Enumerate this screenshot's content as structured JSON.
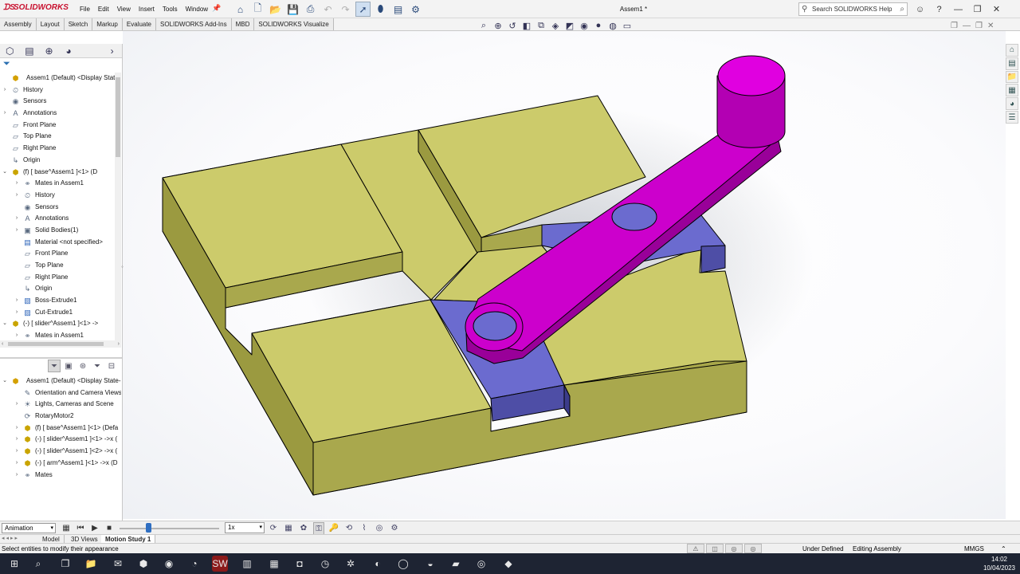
{
  "app": {
    "logo_text": "SOLIDWORKS",
    "document_title": "Assem1 *",
    "menu": [
      "File",
      "Edit",
      "View",
      "Insert",
      "Tools",
      "Window"
    ],
    "search_placeholder": "Search SOLIDWORKS Help"
  },
  "command_tabs": [
    "Assembly",
    "Layout",
    "Sketch",
    "Markup",
    "Evaluate",
    "SOLIDWORKS Add-Ins",
    "MBD",
    "SOLIDWORKS Visualize"
  ],
  "feature_tree": [
    {
      "label": "Assem1 (Default) <Display State",
      "indent": 0,
      "arrow": "",
      "icon": "assembly-icon"
    },
    {
      "label": "History",
      "indent": 0,
      "arrow": "›",
      "icon": "history-icon"
    },
    {
      "label": "Sensors",
      "indent": 0,
      "arrow": "",
      "icon": "sensor-icon"
    },
    {
      "label": "Annotations",
      "indent": 0,
      "arrow": "›",
      "icon": "annotation-icon"
    },
    {
      "label": "Front Plane",
      "indent": 0,
      "arrow": "",
      "icon": "plane-icon"
    },
    {
      "label": "Top Plane",
      "indent": 0,
      "arrow": "",
      "icon": "plane-icon"
    },
    {
      "label": "Right Plane",
      "indent": 0,
      "arrow": "",
      "icon": "plane-icon"
    },
    {
      "label": "Origin",
      "indent": 0,
      "arrow": "",
      "icon": "origin-icon"
    },
    {
      "label": "(f) [ base^Assem1 ]<1> (D",
      "indent": 0,
      "arrow": "⌄",
      "icon": "part-icon"
    },
    {
      "label": "Mates in Assem1",
      "indent": 1,
      "arrow": "›",
      "icon": "mates-icon"
    },
    {
      "label": "History",
      "indent": 1,
      "arrow": "›",
      "icon": "history-icon"
    },
    {
      "label": "Sensors",
      "indent": 1,
      "arrow": "",
      "icon": "sensor-icon"
    },
    {
      "label": "Annotations",
      "indent": 1,
      "arrow": "›",
      "icon": "annotation-icon"
    },
    {
      "label": "Solid Bodies(1)",
      "indent": 1,
      "arrow": "›",
      "icon": "solid-bodies-icon"
    },
    {
      "label": "Material <not specified>",
      "indent": 1,
      "arrow": "",
      "icon": "material-icon"
    },
    {
      "label": "Front Plane",
      "indent": 1,
      "arrow": "",
      "icon": "plane-icon"
    },
    {
      "label": "Top Plane",
      "indent": 1,
      "arrow": "",
      "icon": "plane-icon"
    },
    {
      "label": "Right Plane",
      "indent": 1,
      "arrow": "",
      "icon": "plane-icon"
    },
    {
      "label": "Origin",
      "indent": 1,
      "arrow": "",
      "icon": "origin-icon"
    },
    {
      "label": "Boss-Extrude1",
      "indent": 1,
      "arrow": "›",
      "icon": "extrude-icon"
    },
    {
      "label": "Cut-Extrude1",
      "indent": 1,
      "arrow": "›",
      "icon": "cut-extrude-icon"
    },
    {
      "label": "(-) [ slider^Assem1 ]<1> ->",
      "indent": 0,
      "arrow": "⌄",
      "icon": "part-icon"
    },
    {
      "label": "Mates in Assem1",
      "indent": 1,
      "arrow": "›",
      "icon": "mates-icon"
    }
  ],
  "motion_tree": [
    {
      "label": "Assem1 (Default) <Display State-1",
      "indent": 0,
      "arrow": "⌄",
      "icon": "assembly-icon"
    },
    {
      "label": "Orientation and Camera Views",
      "indent": 1,
      "arrow": "",
      "icon": "camera-icon"
    },
    {
      "label": "Lights, Cameras and Scene",
      "indent": 1,
      "arrow": "›",
      "icon": "lights-icon"
    },
    {
      "label": "RotaryMotor2",
      "indent": 1,
      "arrow": "",
      "icon": "motor-icon"
    },
    {
      "label": "(f) [ base^Assem1 ]<1> (Defa",
      "indent": 1,
      "arrow": "›",
      "icon": "part-icon"
    },
    {
      "label": "(-) [ slider^Assem1 ]<1> ->x (",
      "indent": 1,
      "arrow": "›",
      "icon": "part-icon"
    },
    {
      "label": "(-) [ slider^Assem1 ]<2> ->x (",
      "indent": 1,
      "arrow": "›",
      "icon": "part-icon"
    },
    {
      "label": "(-) [ arm^Assem1 ]<1> ->x (D",
      "indent": 1,
      "arrow": "›",
      "icon": "part-icon"
    },
    {
      "label": "Mates",
      "indent": 1,
      "arrow": "›",
      "icon": "mates-icon"
    }
  ],
  "timeline": {
    "study_type": "Animation",
    "playback_speed": "1x"
  },
  "bottom_tabs": [
    "Model",
    "3D Views",
    "Motion Study 1"
  ],
  "status": {
    "message": "Select entities to modify their appearance",
    "state1": "Under Defined",
    "state2": "Editing Assembly",
    "units": "MMGS"
  },
  "clock": {
    "time": "14:02",
    "date": "10/04/2023"
  },
  "colors": {
    "base": "#cccb6b",
    "slider": "#6b6bcf",
    "arm": "#cc00cc",
    "accent": "#2f6fc2"
  }
}
